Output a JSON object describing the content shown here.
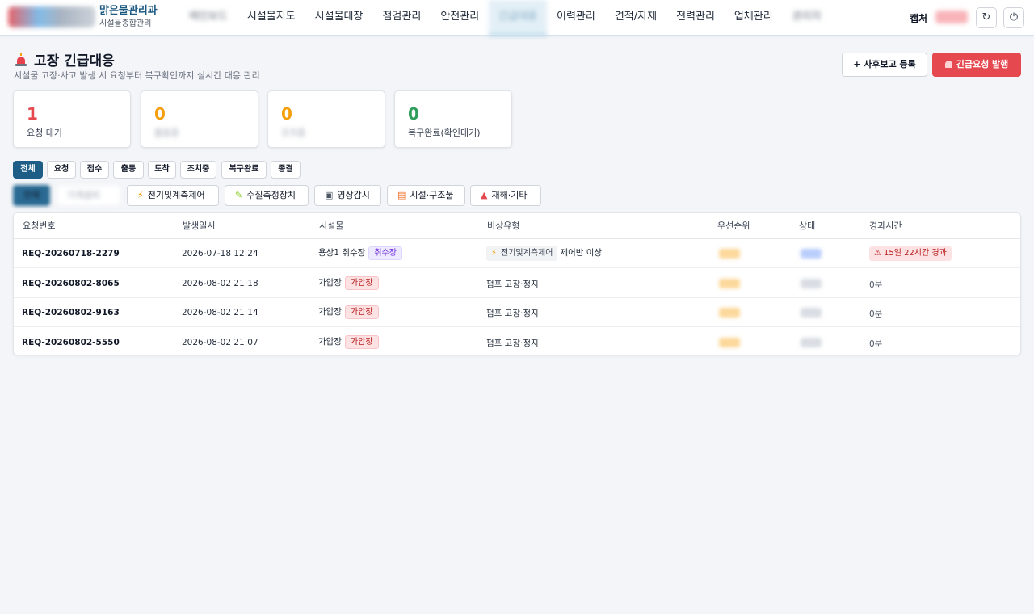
{
  "header": {
    "brand_title": "맑은물관리과",
    "brand_sub": "시설물종합관리",
    "nav": [
      {
        "label": "메인보드",
        "blurred": true
      },
      {
        "label": "시설물지도"
      },
      {
        "label": "시설물대장"
      },
      {
        "label": "점검관리"
      },
      {
        "label": "안전관리"
      },
      {
        "label": "긴급대응",
        "active": true,
        "blurred": true
      },
      {
        "label": "이력관리"
      },
      {
        "label": "견적/자재"
      },
      {
        "label": "전력관리"
      },
      {
        "label": "업체관리"
      },
      {
        "label": "관리자",
        "blurred": true
      }
    ],
    "capture_label": "캡처",
    "user_label": "관리자",
    "refresh_icon": "↻",
    "power_icon": "⏻"
  },
  "page": {
    "title": "고장 긴급대응",
    "subtitle": "시설물 고장·사고 발생 시 요청부터 복구확인까지 실시간 대응 관리",
    "btn_report": "+ 사후보고 등록",
    "btn_emergency": "긴급요청 발행"
  },
  "stats": [
    {
      "value": "1",
      "label": "요청 대기",
      "color": "#e5484f"
    },
    {
      "value": "0",
      "label": "출동중",
      "color": "#f59e0b",
      "blurred": true
    },
    {
      "value": "0",
      "label": "조치중",
      "color": "#f59e0b",
      "blurred": true
    },
    {
      "value": "0",
      "label": "복구완료(확인대기)",
      "color": "#2f9e5b"
    }
  ],
  "status_filters": [
    "전체",
    "요청",
    "접수",
    "출동",
    "도착",
    "조치중",
    "복구완료",
    "종결"
  ],
  "category_filters": [
    {
      "label": "전체",
      "icon": "",
      "blurred": true
    },
    {
      "label": "기계설비",
      "icon": "",
      "blurred": true
    },
    {
      "label": "전기및계측제어",
      "icon": "⚡"
    },
    {
      "label": "수질측정장치",
      "icon": "✎"
    },
    {
      "label": "영상감시",
      "icon": "▣"
    },
    {
      "label": "시설·구조물",
      "icon": "▤"
    },
    {
      "label": "재해·기타",
      "icon": "▲"
    }
  ],
  "table": {
    "columns": [
      "요청번호",
      "발생일시",
      "시설물",
      "비상유형",
      "우선순위",
      "상태",
      "경과시간"
    ],
    "rows": [
      {
        "id": "REQ-20260718-2279",
        "datetime": "2026-07-18 12:24",
        "facility": "용상1 취수장",
        "facility_tag": "취수장",
        "tag_style": "purple",
        "type_chip": "전기및계측제어",
        "type": "제어반 이상",
        "elapsed": "15일 22시간 경과",
        "elapsed_alert": true,
        "state_color": "#b9cdfb"
      },
      {
        "id": "REQ-20260802-8065",
        "datetime": "2026-08-02 21:18",
        "facility": "가압장",
        "facility_tag": "가압장",
        "tag_style": "red",
        "type_chip": "",
        "type": "펌프 고장·정지",
        "elapsed": "0분",
        "elapsed_alert": false,
        "state_color": "#d9dde3"
      },
      {
        "id": "REQ-20260802-9163",
        "datetime": "2026-08-02 21:14",
        "facility": "가압장",
        "facility_tag": "가압장",
        "tag_style": "red",
        "type_chip": "",
        "type": "펌프 고장·정지",
        "elapsed": "0분",
        "elapsed_alert": false,
        "state_color": "#d9dde3"
      },
      {
        "id": "REQ-20260802-5550",
        "datetime": "2026-08-02 21:07",
        "facility": "가압장",
        "facility_tag": "가압장",
        "tag_style": "red",
        "type_chip": "",
        "type": "펌프 고장·정지",
        "elapsed": "0분",
        "elapsed_alert": false,
        "state_color": "#d9dde3"
      }
    ]
  },
  "colors": {
    "brand": "#1d5d86",
    "danger": "#e5484f",
    "warning": "#f59e0b",
    "success": "#2f9e5b"
  }
}
